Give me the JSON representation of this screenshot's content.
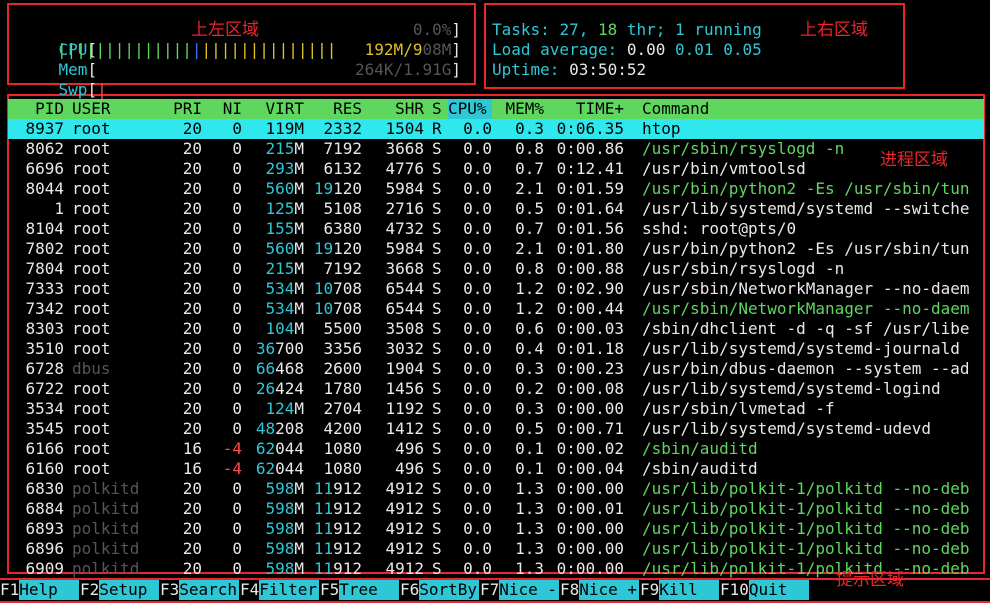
{
  "meters": {
    "cpu": {
      "label": "CPU",
      "value": "0.0%"
    },
    "mem": {
      "label": "Mem",
      "bars": "||||||||||||||||||||||||",
      "value_used": "192M/9",
      "value_rest": "08M"
    },
    "swp": {
      "label": "Swp",
      "bars": "|",
      "value": "264K/1.91G"
    }
  },
  "info": {
    "tasks_label": "Tasks: ",
    "tasks": "27",
    "comma": ", ",
    "threads": "18",
    "thr_label": " thr; ",
    "running": "1",
    "running_label": " running",
    "load_label": "Load average: ",
    "load1": "0.00",
    "load5": "0.01",
    "load15": "0.05",
    "uptime_label": "Uptime: ",
    "uptime": "03:50:52"
  },
  "annotations": {
    "top_left": "上左区域",
    "top_right": "上右区域",
    "process": "进程区域",
    "footer": "提示区域"
  },
  "columns": {
    "pid": "PID",
    "user": "USER",
    "pri": "PRI",
    "ni": "NI",
    "virt": "VIRT",
    "res": "RES",
    "shr": "SHR",
    "s": "S",
    "cpu": "CPU%",
    "mem": "MEM%",
    "time": "TIME+",
    "command": "Command"
  },
  "processes": [
    {
      "pid": "8937",
      "user": "root",
      "pri": "20",
      "ni": "0",
      "virt": "119M",
      "res": "2332",
      "shr": "1504",
      "s": "R",
      "cpu": "0.0",
      "mem": "0.3",
      "time": "0:06.35",
      "command": "htop",
      "selected": true
    },
    {
      "pid": "8062",
      "user": "root",
      "pri": "20",
      "ni": "0",
      "virt": "215M",
      "res": "7192",
      "shr": "3668",
      "s": "S",
      "cpu": "0.0",
      "mem": "0.8",
      "time": "0:00.86",
      "command": "/usr/sbin/rsyslogd -n",
      "thread": true
    },
    {
      "pid": "6696",
      "user": "root",
      "pri": "20",
      "ni": "0",
      "virt": "293M",
      "res": "6132",
      "shr": "4776",
      "s": "S",
      "cpu": "0.0",
      "mem": "0.7",
      "time": "0:12.41",
      "command": "/usr/bin/vmtoolsd"
    },
    {
      "pid": "8044",
      "user": "root",
      "pri": "20",
      "ni": "0",
      "virt": "560M",
      "res": "19120",
      "shr": "5984",
      "s": "S",
      "cpu": "0.0",
      "mem": "2.1",
      "time": "0:01.59",
      "command": "/usr/bin/python2 -Es /usr/sbin/tun",
      "thread": true
    },
    {
      "pid": "1",
      "user": "root",
      "pri": "20",
      "ni": "0",
      "virt": "125M",
      "res": "5108",
      "shr": "2716",
      "s": "S",
      "cpu": "0.0",
      "mem": "0.5",
      "time": "0:01.64",
      "command": "/usr/lib/systemd/systemd --switche"
    },
    {
      "pid": "8104",
      "user": "root",
      "pri": "20",
      "ni": "0",
      "virt": "155M",
      "res": "6380",
      "shr": "4732",
      "s": "S",
      "cpu": "0.0",
      "mem": "0.7",
      "time": "0:01.56",
      "command": "sshd: root@pts/0"
    },
    {
      "pid": "7802",
      "user": "root",
      "pri": "20",
      "ni": "0",
      "virt": "560M",
      "res": "19120",
      "shr": "5984",
      "s": "S",
      "cpu": "0.0",
      "mem": "2.1",
      "time": "0:01.80",
      "command": "/usr/bin/python2 -Es /usr/sbin/tun"
    },
    {
      "pid": "7804",
      "user": "root",
      "pri": "20",
      "ni": "0",
      "virt": "215M",
      "res": "7192",
      "shr": "3668",
      "s": "S",
      "cpu": "0.0",
      "mem": "0.8",
      "time": "0:00.88",
      "command": "/usr/sbin/rsyslogd -n"
    },
    {
      "pid": "7333",
      "user": "root",
      "pri": "20",
      "ni": "0",
      "virt": "534M",
      "res": "10708",
      "shr": "6544",
      "s": "S",
      "cpu": "0.0",
      "mem": "1.2",
      "time": "0:02.90",
      "command": "/usr/sbin/NetworkManager --no-daem"
    },
    {
      "pid": "7342",
      "user": "root",
      "pri": "20",
      "ni": "0",
      "virt": "534M",
      "res": "10708",
      "shr": "6544",
      "s": "S",
      "cpu": "0.0",
      "mem": "1.2",
      "time": "0:00.44",
      "command": "/usr/sbin/NetworkManager --no-daem",
      "thread": true
    },
    {
      "pid": "8303",
      "user": "root",
      "pri": "20",
      "ni": "0",
      "virt": "104M",
      "res": "5500",
      "shr": "3508",
      "s": "S",
      "cpu": "0.0",
      "mem": "0.6",
      "time": "0:00.03",
      "command": "/sbin/dhclient -d -q -sf /usr/libe"
    },
    {
      "pid": "3510",
      "user": "root",
      "pri": "20",
      "ni": "0",
      "virt": "36700",
      "res": "3356",
      "shr": "3032",
      "s": "S",
      "cpu": "0.0",
      "mem": "0.4",
      "time": "0:01.18",
      "command": "/usr/lib/systemd/systemd-journald"
    },
    {
      "pid": "6728",
      "user": "dbus",
      "pri": "20",
      "ni": "0",
      "virt": "66468",
      "res": "2600",
      "shr": "1904",
      "s": "S",
      "cpu": "0.0",
      "mem": "0.3",
      "time": "0:00.23",
      "command": "/usr/bin/dbus-daemon --system --ad",
      "dim_user": true
    },
    {
      "pid": "6722",
      "user": "root",
      "pri": "20",
      "ni": "0",
      "virt": "26424",
      "res": "1780",
      "shr": "1456",
      "s": "S",
      "cpu": "0.0",
      "mem": "0.2",
      "time": "0:00.08",
      "command": "/usr/lib/systemd/systemd-logind"
    },
    {
      "pid": "3534",
      "user": "root",
      "pri": "20",
      "ni": "0",
      "virt": "124M",
      "res": "2704",
      "shr": "1192",
      "s": "S",
      "cpu": "0.0",
      "mem": "0.3",
      "time": "0:00.00",
      "command": "/usr/sbin/lvmetad -f"
    },
    {
      "pid": "3545",
      "user": "root",
      "pri": "20",
      "ni": "0",
      "virt": "48208",
      "res": "4200",
      "shr": "1412",
      "s": "S",
      "cpu": "0.0",
      "mem": "0.5",
      "time": "0:00.71",
      "command": "/usr/lib/systemd/systemd-udevd"
    },
    {
      "pid": "6166",
      "user": "root",
      "pri": "16",
      "ni": "-4",
      "virt": "62044",
      "res": "1080",
      "shr": "496",
      "s": "S",
      "cpu": "0.0",
      "mem": "0.1",
      "time": "0:00.02",
      "command": "/sbin/auditd",
      "thread": true,
      "neg_ni": true
    },
    {
      "pid": "6160",
      "user": "root",
      "pri": "16",
      "ni": "-4",
      "virt": "62044",
      "res": "1080",
      "shr": "496",
      "s": "S",
      "cpu": "0.0",
      "mem": "0.1",
      "time": "0:00.04",
      "command": "/sbin/auditd",
      "neg_ni": true
    },
    {
      "pid": "6830",
      "user": "polkitd",
      "pri": "20",
      "ni": "0",
      "virt": "598M",
      "res": "11912",
      "shr": "4912",
      "s": "S",
      "cpu": "0.0",
      "mem": "1.3",
      "time": "0:00.00",
      "command": "/usr/lib/polkit-1/polkitd --no-deb",
      "thread": true,
      "dim_user": true
    },
    {
      "pid": "6884",
      "user": "polkitd",
      "pri": "20",
      "ni": "0",
      "virt": "598M",
      "res": "11912",
      "shr": "4912",
      "s": "S",
      "cpu": "0.0",
      "mem": "1.3",
      "time": "0:00.01",
      "command": "/usr/lib/polkit-1/polkitd --no-deb",
      "thread": true,
      "dim_user": true
    },
    {
      "pid": "6893",
      "user": "polkitd",
      "pri": "20",
      "ni": "0",
      "virt": "598M",
      "res": "11912",
      "shr": "4912",
      "s": "S",
      "cpu": "0.0",
      "mem": "1.3",
      "time": "0:00.00",
      "command": "/usr/lib/polkit-1/polkitd --no-deb",
      "thread": true,
      "dim_user": true
    },
    {
      "pid": "6896",
      "user": "polkitd",
      "pri": "20",
      "ni": "0",
      "virt": "598M",
      "res": "11912",
      "shr": "4912",
      "s": "S",
      "cpu": "0.0",
      "mem": "1.3",
      "time": "0:00.00",
      "command": "/usr/lib/polkit-1/polkitd --no-deb",
      "thread": true,
      "dim_user": true
    },
    {
      "pid": "6909",
      "user": "polkitd",
      "pri": "20",
      "ni": "0",
      "virt": "598M",
      "res": "11912",
      "shr": "4912",
      "s": "S",
      "cpu": "0.0",
      "mem": "1.3",
      "time": "0:00.00",
      "command": "/usr/lib/polkit-1/polkitd --no-deb",
      "thread": true,
      "dim_user": true
    }
  ],
  "footer": [
    {
      "key": "F1",
      "label": "Help"
    },
    {
      "key": "F2",
      "label": "Setup"
    },
    {
      "key": "F3",
      "label": "Search"
    },
    {
      "key": "F4",
      "label": "Filter"
    },
    {
      "key": "F5",
      "label": "Tree"
    },
    {
      "key": "F6",
      "label": "SortBy"
    },
    {
      "key": "F7",
      "label": "Nice -"
    },
    {
      "key": "F8",
      "label": "Nice +"
    },
    {
      "key": "F9",
      "label": "Kill"
    },
    {
      "key": "F10",
      "label": "Quit"
    }
  ],
  "colors": {
    "cyan": "#2ec7d6",
    "green": "#5fd75f",
    "red": "#ff4a4a",
    "header_bg": "#5fd75f",
    "selected_bg": "#2ee8ee",
    "annotation": "#e8262c"
  }
}
